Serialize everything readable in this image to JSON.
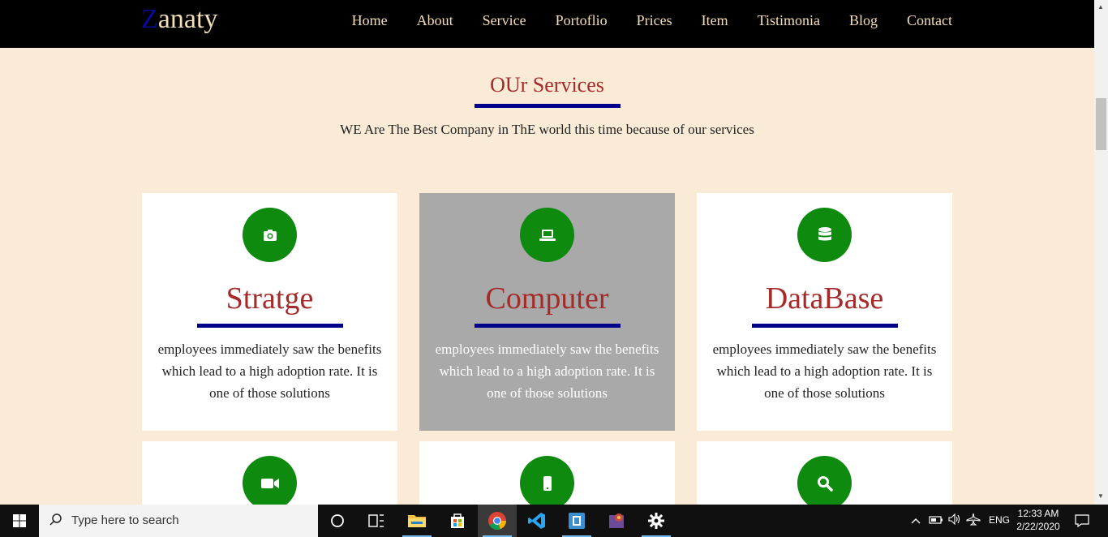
{
  "brand": {
    "first_letter": "Z",
    "rest": "anaty"
  },
  "nav": [
    "Home",
    "About",
    "Service",
    "Portoflio",
    "Prices",
    "Item",
    "Tistimonia",
    "Blog",
    "Contact"
  ],
  "section": {
    "title": "OUr Services",
    "subtitle": "WE Are The Best Company in ThE world this time because of our services"
  },
  "cards": [
    {
      "icon": "camera-icon",
      "title": "Stratge",
      "text": "employees immediately saw the benefits which lead to a high adoption rate. It is one of those solutions",
      "active": false
    },
    {
      "icon": "laptop-icon",
      "title": "Computer",
      "text": "employees immediately saw the benefits which lead to a high adoption rate. It is one of those solutions",
      "active": true
    },
    {
      "icon": "database-icon",
      "title": "DataBase",
      "text": "employees immediately saw the benefits which lead to a high adoption rate. It is one of those solutions",
      "active": false
    },
    {
      "icon": "video-camera-icon"
    },
    {
      "icon": "mobile-icon"
    },
    {
      "icon": "search-icon"
    }
  ],
  "colors": {
    "page_bg": "#faebd7",
    "nav_bg": "#000000",
    "title_color": "#a52a2a",
    "underline": "#00008b",
    "icon_circle": "#0e8a0e",
    "active_card": "#a9a9a9"
  },
  "taskbar": {
    "search_placeholder": "Type here to search",
    "language": "ENG",
    "time": "12:33 AM",
    "date": "2/22/2020"
  }
}
